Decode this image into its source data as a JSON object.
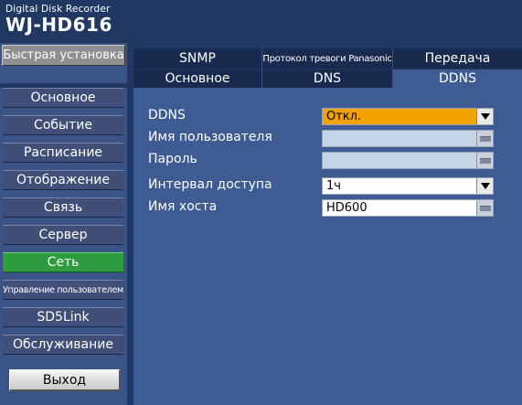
{
  "header": {
    "brand_small": "Digital Disk Recorder",
    "brand_model": "WJ-HD616"
  },
  "sidebar": {
    "quick_setup": "Быстрая установка",
    "items": [
      {
        "label": "Основное"
      },
      {
        "label": "Событие"
      },
      {
        "label": "Расписание"
      },
      {
        "label": "Отображение"
      },
      {
        "label": "Связь"
      },
      {
        "label": "Сервер"
      },
      {
        "label": "Сеть",
        "active": true
      },
      {
        "label": "Управление пользователем"
      },
      {
        "label": "SD5Link"
      },
      {
        "label": "Обслуживание"
      }
    ],
    "exit_label": "Выход"
  },
  "tabs_row1": [
    {
      "label": "SNMP"
    },
    {
      "label": "Протокол тревоги Panasonic"
    },
    {
      "label": "Передача"
    }
  ],
  "tabs_row2": [
    {
      "label": "Основное"
    },
    {
      "label": "DNS"
    },
    {
      "label": "DDNS",
      "selected": true
    }
  ],
  "form": {
    "ddns": {
      "label": "DDNS",
      "value": "Откл."
    },
    "username": {
      "label": "Имя пользователя",
      "value": ""
    },
    "password": {
      "label": "Пароль",
      "value": ""
    },
    "access_interval": {
      "label": "Интервал доступа",
      "value": "1ч"
    },
    "host_name": {
      "label": "Имя хоста",
      "value": "HD600"
    }
  },
  "colors": {
    "background": "#213863",
    "panel": "#3e5c93",
    "active_menu": "#2e9b3e",
    "highlight_field": "#f2a300"
  },
  "icons": [
    "dropdown-arrow-icon",
    "keyboard-icon"
  ]
}
